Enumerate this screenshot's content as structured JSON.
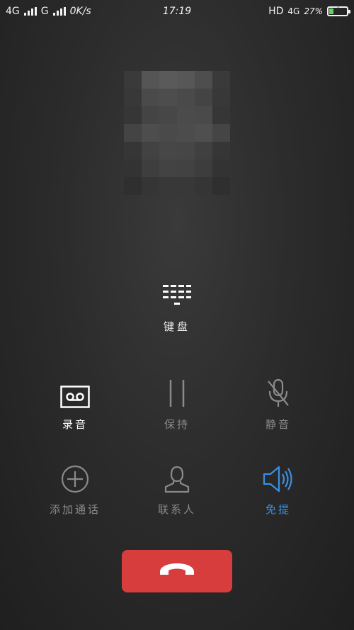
{
  "status_bar": {
    "sim1_network": "4G",
    "sim2_network": "G",
    "data_speed": "0K/s",
    "time": "17:19",
    "hd": "HD",
    "lte": "4G",
    "battery_percent": "27%",
    "battery_level": 0.27,
    "battery_charging": true
  },
  "keypad": {
    "label": "键盘"
  },
  "actions": {
    "record": {
      "label": "录音",
      "icon": "record-cassette-icon",
      "color": "#ffffff"
    },
    "hold": {
      "label": "保持",
      "icon": "pause-icon",
      "color": "#8a8a8a"
    },
    "mute": {
      "label": "静音",
      "icon": "mic-muted-icon",
      "color": "#8a8a8a"
    },
    "add_call": {
      "label": "添加通话",
      "icon": "plus-circle-icon",
      "color": "#8a8a8a"
    },
    "contacts": {
      "label": "联系人",
      "icon": "person-icon",
      "color": "#8a8a8a"
    },
    "speaker": {
      "label": "免提",
      "icon": "speaker-icon",
      "color": "#3b8fe0"
    }
  },
  "end_call": {
    "color": "#d73d3d",
    "icon": "hang-up-icon"
  }
}
